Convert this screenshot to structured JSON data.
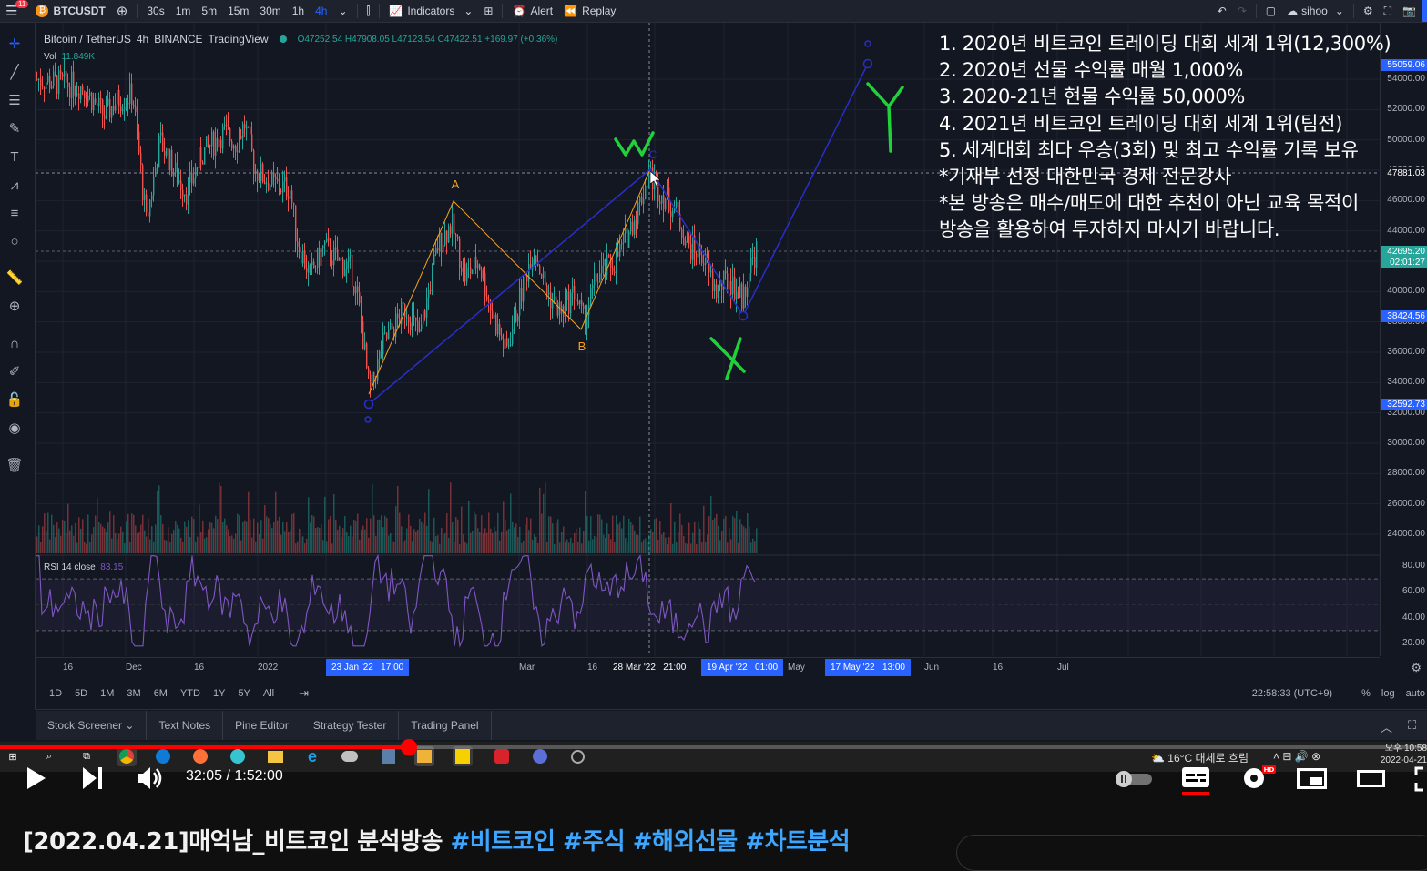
{
  "toolbar": {
    "symbol": "BTCUSDT",
    "intervals": [
      "30s",
      "1m",
      "5m",
      "15m",
      "30m",
      "1h",
      "4h"
    ],
    "active_interval": "4h",
    "indicators_label": "Indicators",
    "alert_label": "Alert",
    "replay_label": "Replay",
    "layout_name": "sihoo",
    "notification_count": "11"
  },
  "legend": {
    "title": "Bitcoin / TetherUS",
    "interval": "4h",
    "exchange": "BINANCE",
    "source": "TradingView",
    "ohlc": "O47252.54 H47908.05 L47123.54 C47422.51 +169.97 (+0.36%)",
    "vol_label": "Vol",
    "vol_value": "11.849K",
    "rsi_label": "RSI 14 close",
    "rsi_value": "83.15"
  },
  "wave_labels": {
    "a": "A",
    "b": "B",
    "c": "C",
    "w": "W",
    "x": "X",
    "y": "Y"
  },
  "price_axis": {
    "ticks": [
      "54000.00",
      "52000.00",
      "50000.00",
      "48000.00",
      "46000.00",
      "44000.00",
      "42000.00",
      "40000.00",
      "38000.00",
      "36000.00",
      "34000.00",
      "32000.00",
      "30000.00",
      "28000.00",
      "26000.00",
      "24000.00"
    ],
    "rsi_ticks": [
      "80.00",
      "60.00",
      "40.00",
      "20.00"
    ],
    "tags": [
      {
        "label": "55059.06",
        "color": "#2962ff"
      },
      {
        "label": "47881.03",
        "color": "#131722"
      },
      {
        "label": "42695.20",
        "color": "#26a69a"
      },
      {
        "label": "02:01:27",
        "color": "#26a69a"
      },
      {
        "label": "38424.56",
        "color": "#2962ff"
      },
      {
        "label": "32592.73",
        "color": "#2962ff"
      }
    ]
  },
  "time_axis": {
    "ticks": [
      "16",
      "Dec",
      "16",
      "2022",
      "Mar",
      "16",
      "May",
      "Jun",
      "16",
      "Jul"
    ],
    "tags": [
      "23 Jan '22   17:00",
      "28 Mar '22   21:00",
      "19 Apr '22   01:00",
      "17 May '22   13:00"
    ]
  },
  "ranges": {
    "items": [
      "1D",
      "5D",
      "1M",
      "3M",
      "6M",
      "YTD",
      "1Y",
      "5Y",
      "All"
    ],
    "clock": "22:58:33 (UTC+9)",
    "percent": "%",
    "log": "log",
    "auto": "auto"
  },
  "bottom_tabs": [
    "Stock Screener",
    "Text Notes",
    "Pine Editor",
    "Strategy Tester",
    "Trading Panel"
  ],
  "overlay_text": [
    "1. 2020년 비트코인 트레이딩 대회 세계 1위(12,300%)",
    "2. 2020년 선물 수익률 매월 1,000%",
    "3. 2020-21년 현물 수익률 50,000%",
    "4. 2021년 비트코인 트레이딩 대회 세계 1위(팀전)",
    "5. 세계대회 최다 우승(3회) 및 최고 수익률 기록 보유",
    "*기재부 선정 대한민국 경제 전문강사",
    "*본 방송은 매수/매도에 대한 추천이 아닌 교육 목적이",
    " 방송을 활용하여 투자하지 마시기 바랍니다."
  ],
  "taskbar": {
    "weather": "16°C  대체로 흐림",
    "time": "오후 10:58",
    "date": "2022-04-21"
  },
  "video": {
    "time": "32:05 / 1:52:00",
    "progress": 0.2864,
    "title_prefix": "[2022.04.21]매억남_비트코인 분석방송 ",
    "hashtags": [
      "#비트코인",
      "#주식",
      "#해외선물",
      "#차트분석"
    ],
    "accent_color": "#ff0000"
  }
}
